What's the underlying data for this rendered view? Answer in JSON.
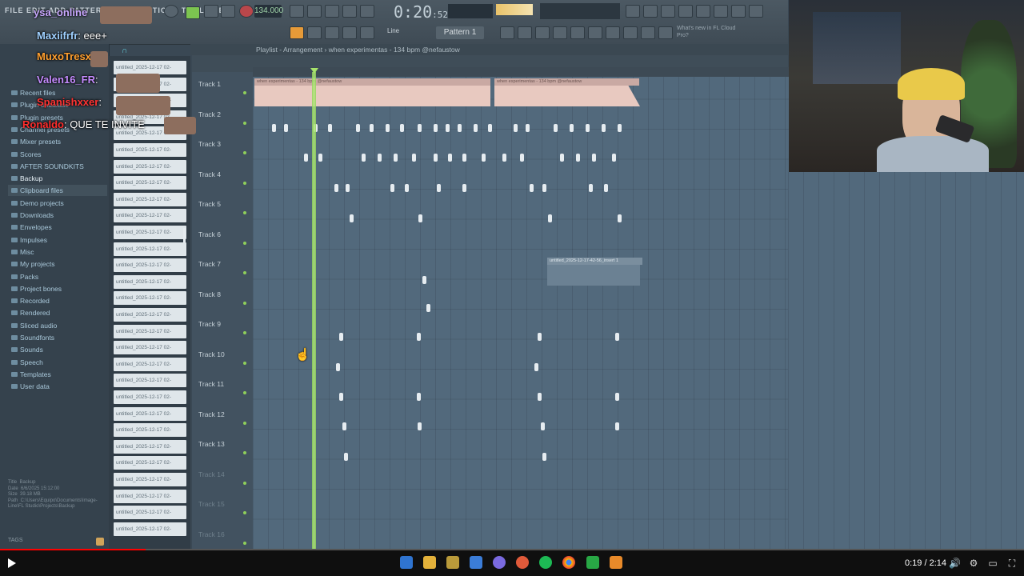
{
  "toolbar": {
    "menu": "FILE EDIT ADD PATTERNS VIEW OPTIONS TOOLS HELP",
    "tempo": "134.000",
    "clock": "0:20",
    "clock_sub": ":52",
    "pattern": "Pattern 1",
    "line_mode": "Line",
    "news": "What's new in FL Cloud Pro?"
  },
  "playlist": {
    "title": "Playlist - Arrangement › when experimentas - 134 bpm @nefaustow",
    "tracks": [
      "Track 1",
      "Track 2",
      "Track 3",
      "Track 4",
      "Track 5",
      "Track 6",
      "Track 7",
      "Track 8",
      "Track 9",
      "Track 10",
      "Track 11",
      "Track 12",
      "Track 13",
      "Track 14",
      "Track 15",
      "Track 16"
    ],
    "clip_label_1": "when experimentas - 134 bpm @nefaustow",
    "clip_label_2": "when experimentas - 134 bpm @nefaustow",
    "clip_label_3": "untitled_2025-12-17-42-56_insert 1"
  },
  "browser": {
    "items": [
      "Recent files",
      "Plugin database",
      "Plugin presets",
      "Channel presets",
      "Mixer presets",
      "Scores",
      "AFTER SOUNDKITS",
      "Backup",
      "Clipboard files",
      "Demo projects",
      "Downloads",
      "Envelopes",
      "Impulses",
      "Misc",
      "My projects",
      "Packs",
      "Project bones",
      "Recorded",
      "Rendered",
      "Sliced audio",
      "Soundfonts",
      "Sounds",
      "Speech",
      "Templates",
      "User data"
    ],
    "selected": "Backup",
    "info": "Title  Backup\nDate  6/6/2025 15:12:00\nSize  39.18 MB\nPath  C:\\Users\\Equipo\\Documents\\Image-Line\\FL Studio\\Projects\\Backup",
    "tags": "TAGS"
  },
  "files": {
    "name": "untitled_2025-12-17 02-"
  },
  "chat": [
    {
      "user": "ysa_online",
      "text": "",
      "color": "#c8a8ff"
    },
    {
      "user": "Maxiifrfr",
      "text": ": eee+",
      "color": "#9fd0ff"
    },
    {
      "user": "MuxoTresx",
      "text": ":",
      "color": "#ff9f2f"
    },
    {
      "user": "Valen16_FR",
      "text": ":",
      "color": "#c58cff"
    },
    {
      "user": "Spanishxxer",
      "text": ":",
      "color": "#ff3333"
    },
    {
      "user": "Ronaldo",
      "text": ": QUE TE INVITE",
      "color": "#ff2d2d"
    }
  ],
  "player": {
    "time": "0:19 / 2:14",
    "progress_fraction": 0.142
  },
  "colors": {
    "playhead": "#a7e36b",
    "audio_clip": "#e8c9c0",
    "grid": "#52697c",
    "progress": "#ff0000"
  },
  "icons": [
    "play-icon",
    "volume-icon",
    "settings-icon",
    "fullscreen-icon",
    "windows-start-icon",
    "file-explorer-icon",
    "chrome-icon",
    "spotify-icon"
  ]
}
